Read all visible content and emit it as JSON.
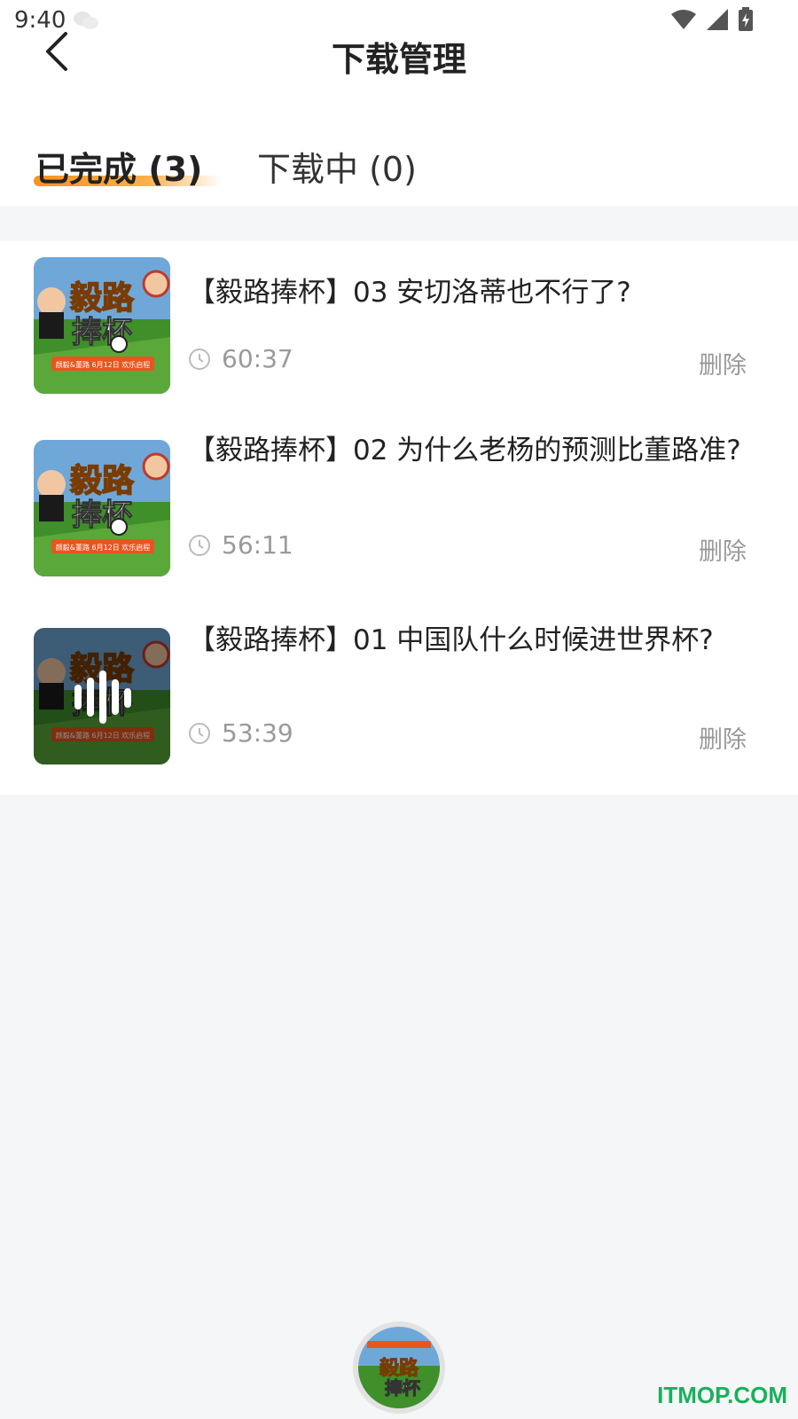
{
  "status_bar": {
    "time": "9:40"
  },
  "header": {
    "title": "下载管理"
  },
  "tabs": [
    {
      "label": "已完成 (3)",
      "active": true
    },
    {
      "label": "下载中 (0)",
      "active": false
    }
  ],
  "items": [
    {
      "title": "【毅路捧杯】03 安切洛蒂也不行了?",
      "duration": "60:37",
      "delete_label": "删除",
      "playing": false
    },
    {
      "title": "【毅路捧杯】02 为什么老杨的预测比董路准?",
      "duration": "56:11",
      "delete_label": "删除",
      "playing": false
    },
    {
      "title": "【毅路捧杯】01 中国队什么时候进世界杯?",
      "duration": "53:39",
      "delete_label": "删除",
      "playing": true
    }
  ],
  "cover_text": {
    "line1": "毅路",
    "line2": "捧杯",
    "banner": "颜毅&董路 6月12日 欢乐启程"
  },
  "watermark": "ITMOP.COM",
  "colors": {
    "accent": "#f7931e",
    "text": "#222222",
    "muted": "#9a9a9a",
    "field": "#3f8f2a",
    "watermark": "#18b15b"
  }
}
